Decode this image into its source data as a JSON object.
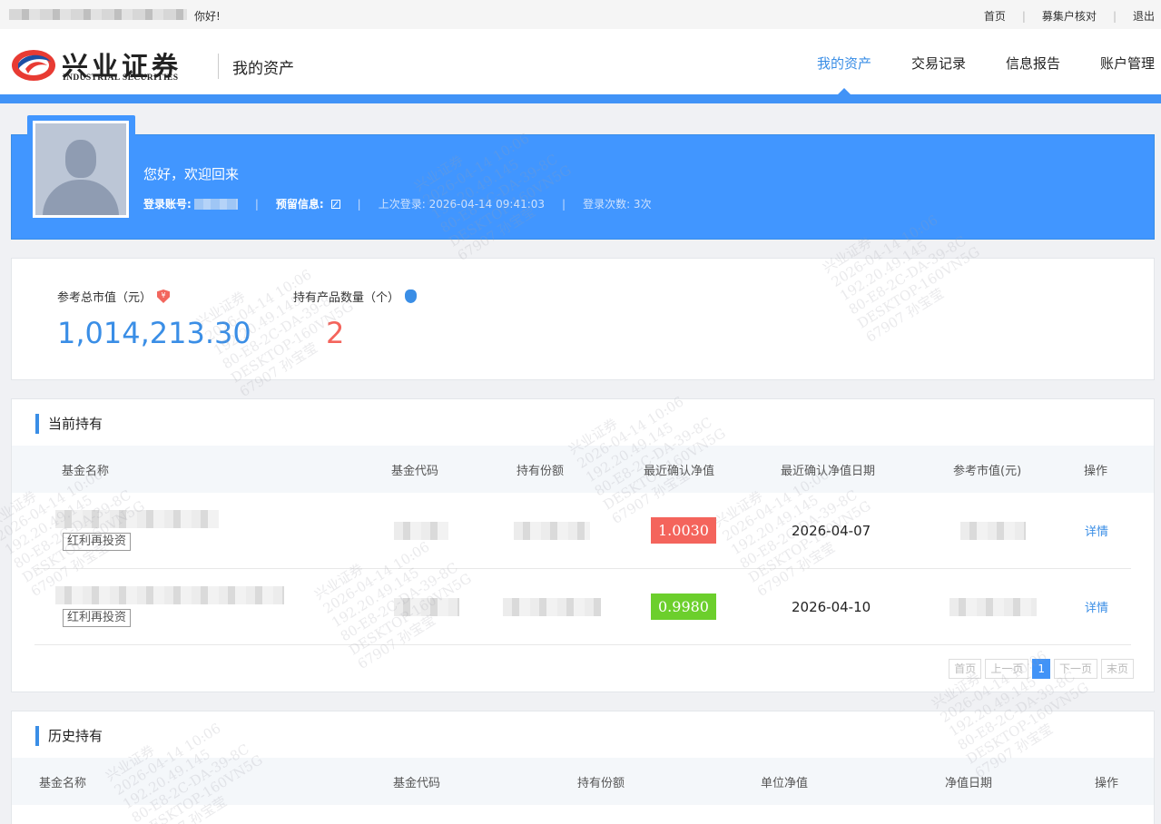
{
  "topbar": {
    "greeting": "你好!",
    "links": [
      "首页",
      "募集户核对",
      "退出"
    ]
  },
  "header": {
    "logo_cn": "兴业证券",
    "logo_en": "INDUSTRIAL SECURITIES",
    "section_title": "我的资产",
    "nav": [
      "我的资产",
      "交易记录",
      "信息报告",
      "账户管理"
    ],
    "active_nav": "我的资产"
  },
  "profile": {
    "welcome": "您好，欢迎回来",
    "account_label": "登录账号:",
    "reserved_label": "预留信息:",
    "last_login": "上次登录: 2026-04-14 09:41:03",
    "login_count": "登录次数: 3次"
  },
  "summary": {
    "total_label": "参考总市值（元）",
    "total_value": "1,014,213.30",
    "count_label": "持有产品数量（个）",
    "count_value": "2",
    "total_icon": "¥"
  },
  "holdings": {
    "title": "当前持有",
    "columns": [
      "基金名称",
      "基金代码",
      "持有份额",
      "最近确认净值",
      "最近确认净值日期",
      "参考市值(元)",
      "操作"
    ],
    "rows": [
      {
        "tag": "红利再投资",
        "nav": "1.0030",
        "nav_color": "#f4645c",
        "date": "2026-04-07",
        "action": "详情"
      },
      {
        "tag": "红利再投资",
        "nav": "0.9980",
        "nav_color": "#6ccf2c",
        "date": "2026-04-10",
        "action": "详情"
      }
    ],
    "pager": [
      "首页",
      "上一页",
      "1",
      "下一页",
      "末页"
    ]
  },
  "history": {
    "title": "历史持有",
    "columns": [
      "基金名称",
      "基金代码",
      "持有份额",
      "单位净值",
      "净值日期",
      "操作"
    ]
  },
  "colors": {
    "accent": "#4193f7",
    "up": "#f4645c",
    "down": "#6ccf2c"
  },
  "watermark": "兴业证券\n2026-04-14 10:06\n192.20.49.145\n80-E8-2C-DA-39-8C\nDESKTOP-160VN5G\n67907 孙宝莹"
}
